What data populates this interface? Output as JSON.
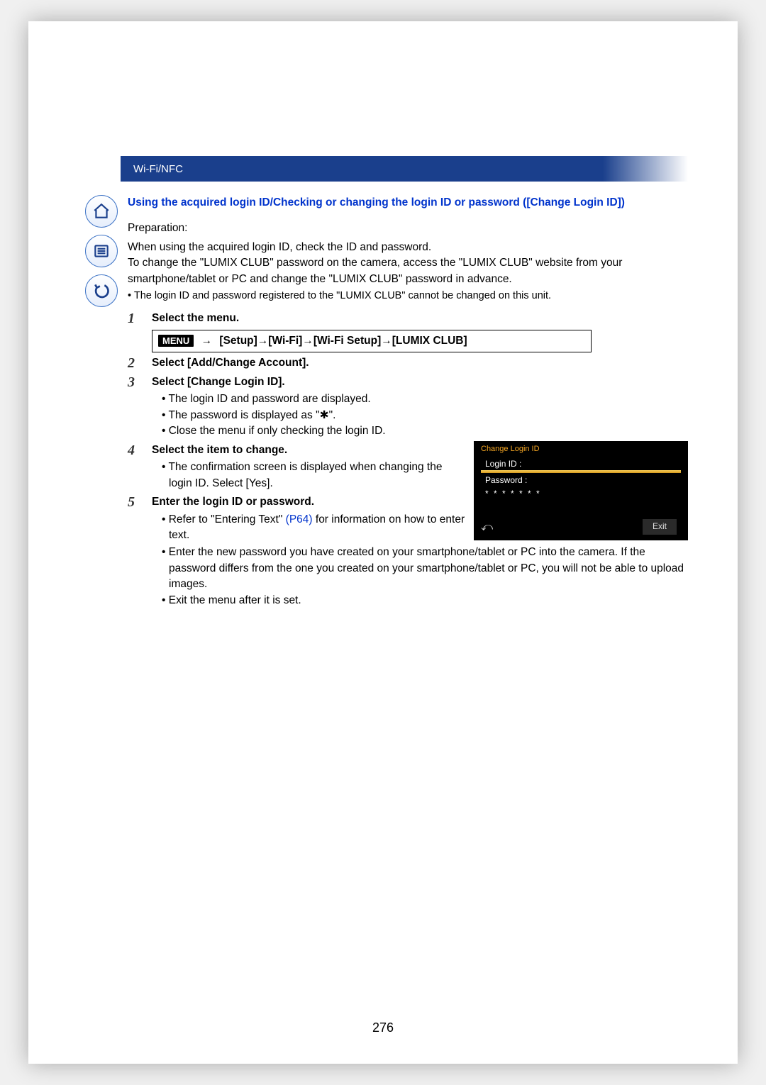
{
  "header": {
    "section": "Wi-Fi/NFC"
  },
  "side_icons": [
    "home-icon",
    "toc-icon",
    "back-icon"
  ],
  "title": "Using the acquired login ID/Checking or changing the login ID or password ([Change Login ID])",
  "preparation": {
    "label": "Preparation:",
    "line1": "When using the acquired login ID, check the ID and password.",
    "line2": "To change the \"LUMIX CLUB\" password on the camera, access the \"LUMIX CLUB\" website from your smartphone/tablet or PC and change the \"LUMIX CLUB\" password in advance.",
    "note": "The login ID and password registered to the \"LUMIX CLUB\" cannot be changed on this unit."
  },
  "menu_badge": "MENU",
  "menu_path": "[Setup]→[Wi-Fi]→[Wi-Fi Setup]→[LUMIX CLUB]",
  "steps": {
    "num1": "1",
    "s1": "Select the menu.",
    "num2": "2",
    "s2": "Select [Add/Change Account].",
    "num3": "3",
    "s3": "Select [Change Login ID].",
    "s3b1": "The login ID and password are displayed.",
    "s3b2_a": "The password is displayed as \"",
    "s3b2_star": "✱",
    "s3b2_b": "\".",
    "s3b3": "Close the menu if only checking the login ID.",
    "num4": "4",
    "s4": "Select the item to change.",
    "s4b1": "The confirmation screen is displayed when changing the login ID. Select [Yes].",
    "num5": "5",
    "s5": "Enter the login ID or password.",
    "s5b1_a": "Refer to \"Entering Text\" ",
    "s5b1_link": "(P64)",
    "s5b1_b": " for information on how to enter text.",
    "s5b2": "Enter the new password you have created on your smartphone/tablet or PC into the camera. If the password differs from the one you created on your smartphone/tablet or PC, you will not be able to upload images.",
    "s5b3": "Exit the menu after it is set."
  },
  "thumb": {
    "title": "Change Login ID",
    "login": "Login ID :",
    "sel": "",
    "password": "Password :",
    "stars": "* * * * * * *",
    "exit": "Exit"
  },
  "arrow": "→",
  "page_number": "276"
}
